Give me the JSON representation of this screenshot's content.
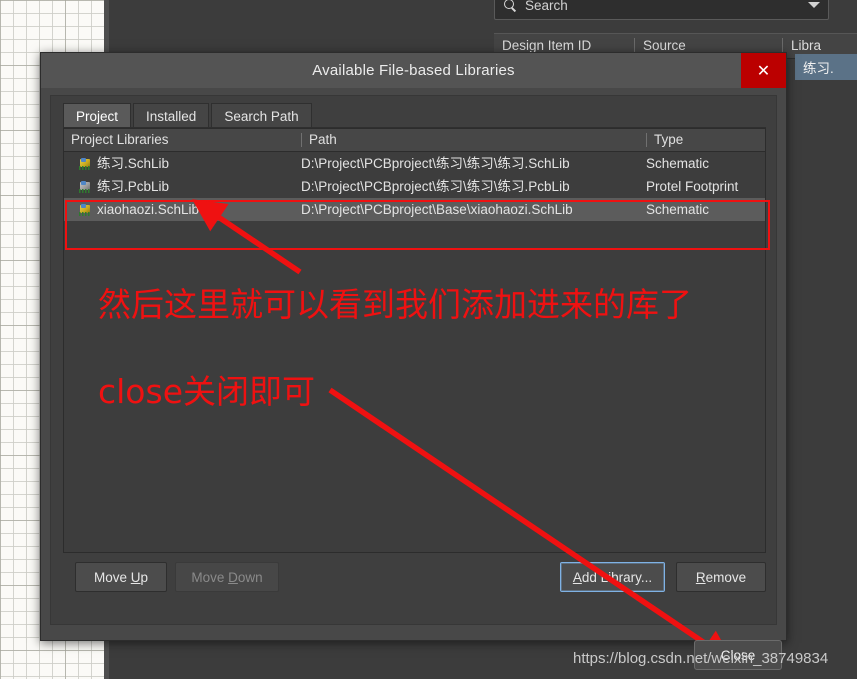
{
  "background": {
    "search": {
      "placeholder": "Search",
      "icon": "search-icon",
      "dropdown_icon": "chevron-down-icon"
    },
    "table_headers": [
      "Design Item ID",
      "Source",
      "Libra"
    ],
    "selected_row_label": "练习."
  },
  "dialog": {
    "title": "Available File-based Libraries",
    "close_x_label": "✕",
    "tabs": [
      {
        "label": "Project",
        "active": true
      },
      {
        "label": "Installed",
        "active": false
      },
      {
        "label": "Search Path",
        "active": false
      }
    ],
    "table": {
      "columns": [
        "Project Libraries",
        "Path",
        "Type"
      ],
      "rows": [
        {
          "name": "练习.SchLib",
          "path": "D:\\Project\\PCBproject\\练习\\练习\\练习.SchLib",
          "type": "Schematic",
          "icon": "schematic-library-icon",
          "selected": false
        },
        {
          "name": "练习.PcbLib",
          "path": "D:\\Project\\PCBproject\\练习\\练习\\练习.PcbLib",
          "type": "Protel Footprint",
          "icon": "pcb-library-icon",
          "selected": false
        },
        {
          "name": "xiaohaozi.SchLib",
          "path": "D:\\Project\\PCBproject\\Base\\xiaohaozi.SchLib",
          "type": "Schematic",
          "icon": "schematic-library-icon",
          "selected": true
        }
      ]
    },
    "buttons": {
      "move_up": "Move Up",
      "move_down": "Move Down",
      "add_library": "Add Library...",
      "remove": "Remove",
      "close": "Close"
    }
  },
  "annotations": {
    "text_1": "然后这里就可以看到我们添加进来的库了",
    "text_2": "close关闭即可",
    "highlight_color": "#ef1111"
  },
  "watermark": "https://blog.csdn.net/weixin_38749834"
}
